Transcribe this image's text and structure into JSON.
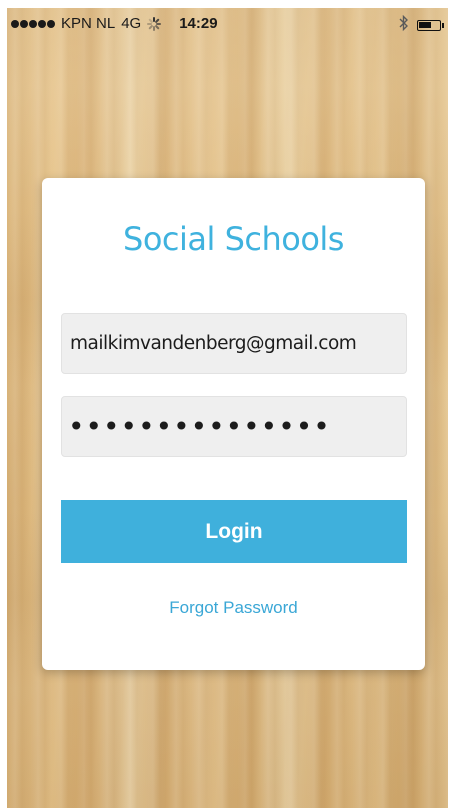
{
  "status_bar": {
    "carrier": "KPN NL",
    "network": "4G",
    "time": "14:29",
    "signal_strength": 5,
    "bluetooth_icon": "bluetooth-icon",
    "battery_icon": "battery-icon",
    "battery_level": 0.6
  },
  "login": {
    "title": "Social Schools",
    "email_value": "mailkimvandenberg@gmail.com",
    "password_value": "•••••••••••••••",
    "login_label": "Login",
    "forgot_label": "Forgot Password"
  },
  "colors": {
    "accent": "#3fb0dc",
    "title": "#3fb2de",
    "field_bg": "#efefef",
    "card_bg": "#ffffff"
  }
}
